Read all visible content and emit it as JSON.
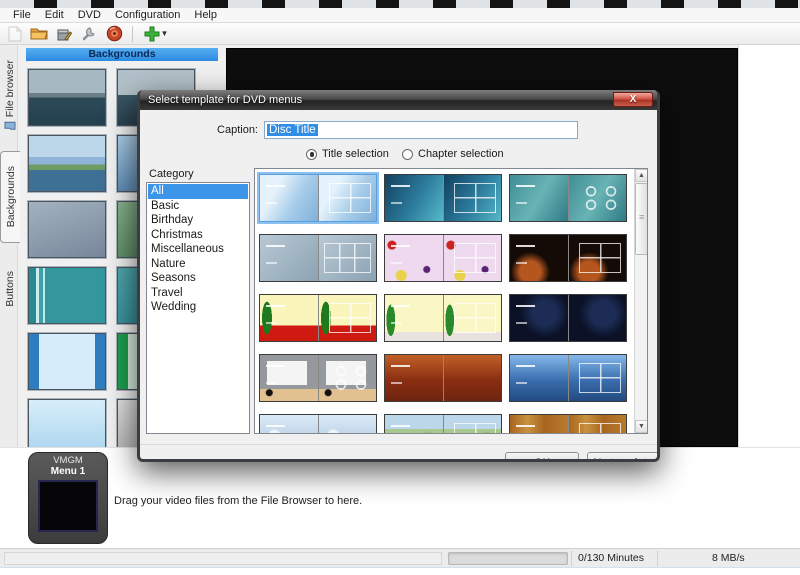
{
  "window": {
    "menu": [
      "File",
      "Edit",
      "DVD",
      "Configuration",
      "Help"
    ],
    "toolbar_icons": [
      "new-icon",
      "open-icon",
      "package-icon",
      "wrench-icon",
      "burn-icon",
      "add-menu-icon"
    ],
    "tabs": [
      "File browser",
      "Backgrounds",
      "Buttons"
    ],
    "backgrounds_header": "Backgrounds",
    "background_thumbs": [
      "ocean",
      "ocean2",
      "lake",
      "bluegrad",
      "grayblue",
      "green",
      "tealstripes",
      "teal2",
      "blueframe",
      "greenframe",
      "lightblue",
      "gray"
    ],
    "vmgm": {
      "label": "VMGM",
      "menu": "Menu 1"
    },
    "drop_hint": "Drag your video files from the File Browser to here.",
    "status": {
      "minutes": "0/130 Minutes",
      "rate": "8 MB/s"
    }
  },
  "dialog": {
    "title": "Select template for DVD menus",
    "close_glyph": "X",
    "caption_label": "Caption:",
    "caption_value": "Disc Title",
    "radio_title": "Title selection",
    "radio_chapter": "Chapter selection",
    "category_label": "Category",
    "categories": [
      "All",
      "Basic",
      "Birthday",
      "Christmas",
      "Miscellaneous",
      "Nature",
      "Seasons",
      "Travel",
      "Wedding"
    ],
    "selected_category": "All",
    "templates": [
      {
        "style": "basicblue",
        "marks": "squares4",
        "selected": true
      },
      {
        "style": "teal",
        "marks": "squares4",
        "selected": false
      },
      {
        "style": "aqua",
        "marks": "circles",
        "selected": false
      },
      {
        "style": "grayblue",
        "marks": "squares6",
        "selected": false
      },
      {
        "style": "pink",
        "marks": "squares4",
        "selected": false
      },
      {
        "style": "cake",
        "marks": "squares4",
        "selected": false
      },
      {
        "style": "xmas",
        "marks": "squares4",
        "selected": false
      },
      {
        "style": "xmastree",
        "marks": "squares4",
        "selected": false
      },
      {
        "style": "navy",
        "marks": "none",
        "selected": false
      },
      {
        "style": "penguin",
        "marks": "circles",
        "selected": false
      },
      {
        "style": "fire",
        "marks": "none",
        "selected": false
      },
      {
        "style": "city",
        "marks": "squares4",
        "selected": false
      },
      {
        "style": "winter",
        "marks": "none",
        "selected": false
      },
      {
        "style": "spring",
        "marks": "squares4",
        "selected": false
      },
      {
        "style": "wood",
        "marks": "squares4",
        "selected": false
      }
    ],
    "ok_label": "OK",
    "no_template_label": "No template"
  }
}
